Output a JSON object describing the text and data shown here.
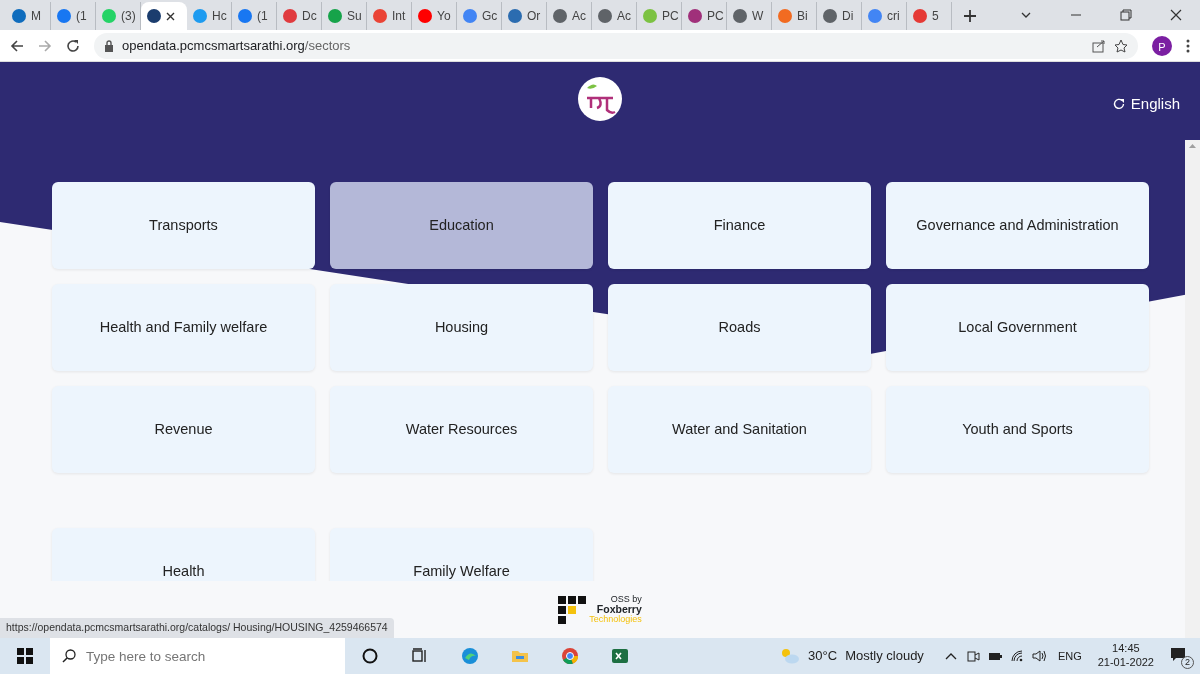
{
  "browser": {
    "tabs": [
      {
        "title": "M",
        "selected": false,
        "color": "#0f6cbd"
      },
      {
        "title": "(1",
        "selected": false,
        "color": "#1877f2"
      },
      {
        "title": "(3)",
        "selected": false,
        "color": "#25d366"
      },
      {
        "selected": true,
        "color": "#1b3d6e"
      },
      {
        "title": "Hc",
        "selected": false,
        "color": "#1d9bf0"
      },
      {
        "title": "(1",
        "selected": false,
        "color": "#1877f2"
      },
      {
        "title": "Dc",
        "selected": false,
        "color": "#e03a3e"
      },
      {
        "title": "Su",
        "selected": false,
        "color": "#16a34a"
      },
      {
        "title": "Int",
        "selected": false,
        "color": "#ea4335"
      },
      {
        "title": "Yo",
        "selected": false,
        "color": "#ff0000"
      },
      {
        "title": "Gc",
        "selected": false,
        "color": "#4285f4"
      },
      {
        "title": "Or",
        "selected": false,
        "color": "#2b6cb0"
      },
      {
        "title": "Ac",
        "selected": false,
        "color": "#5f6368"
      },
      {
        "title": "Ac",
        "selected": false,
        "color": "#5f6368"
      },
      {
        "title": "PC",
        "selected": false,
        "color": "#7cc242"
      },
      {
        "title": "PC",
        "selected": false,
        "color": "#a0307a"
      },
      {
        "title": "W",
        "selected": false,
        "color": "#5f6368"
      },
      {
        "title": "Bi",
        "selected": false,
        "color": "#f26b21"
      },
      {
        "title": "Di",
        "selected": false,
        "color": "#5f6368"
      },
      {
        "title": "cri",
        "selected": false,
        "color": "#4285f4"
      },
      {
        "title": "5",
        "selected": false,
        "color": "#e53935"
      }
    ],
    "url_host": "opendata.pcmcsmartsarathi.org",
    "url_path": "/sectors",
    "profile": "P",
    "status_url": "https://opendata.pcmcsmartsarathi.org/catalogs/ Housing/HOUSING_4259466574"
  },
  "header": {
    "language": "English"
  },
  "sectors": [
    {
      "name": "Transports",
      "selected": false
    },
    {
      "name": "Education",
      "selected": true
    },
    {
      "name": "Finance",
      "selected": false
    },
    {
      "name": "Governance and Administration",
      "selected": false
    },
    {
      "name": "Health and Family welfare",
      "selected": false
    },
    {
      "name": "Housing",
      "selected": false
    },
    {
      "name": "Roads",
      "selected": false
    },
    {
      "name": "Local Government",
      "selected": false
    },
    {
      "name": "Revenue",
      "selected": false
    },
    {
      "name": "Water Resources",
      "selected": false
    },
    {
      "name": "Water and Sanitation",
      "selected": false
    },
    {
      "name": "Youth and Sports",
      "selected": false
    },
    {
      "name": "Health",
      "selected": false
    },
    {
      "name": "Family Welfare",
      "selected": false
    }
  ],
  "footer": {
    "oss": "OSS by",
    "company": "Foxberry",
    "company_sub": "Technologies"
  },
  "taskbar": {
    "search_placeholder": "Type here to search",
    "temperature": "30°C",
    "weather": "Mostly cloudy",
    "language": "ENG",
    "time": "14:45",
    "date": "21-01-2022",
    "notifications": "2"
  }
}
